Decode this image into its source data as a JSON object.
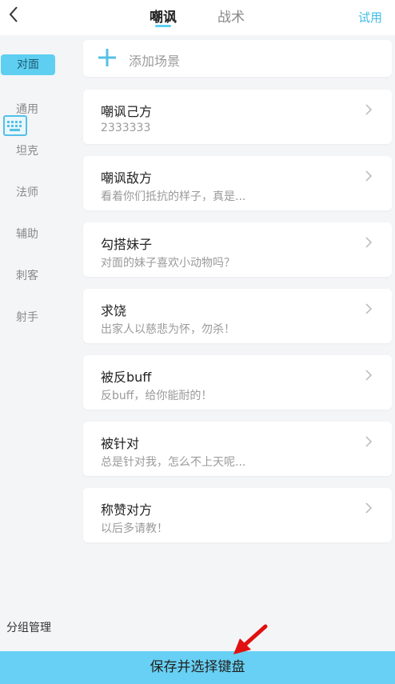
{
  "header": {
    "tabs": [
      {
        "label": "嘲讽",
        "active": true
      },
      {
        "label": "战术",
        "active": false
      }
    ],
    "right_link": "试用"
  },
  "sidebar": {
    "categories": [
      {
        "label": "对面",
        "active": true
      },
      {
        "label": "通用",
        "active": false
      },
      {
        "label": "坦克",
        "active": false
      },
      {
        "label": "法师",
        "active": false
      },
      {
        "label": "辅助",
        "active": false
      },
      {
        "label": "刺客",
        "active": false
      },
      {
        "label": "射手",
        "active": false
      }
    ],
    "group_manage": "分组管理"
  },
  "add_scene": {
    "label": "添加场景"
  },
  "items": [
    {
      "title": "嘲讽己方",
      "subtitle": "2333333"
    },
    {
      "title": "嘲讽敌方",
      "subtitle": "看着你们抵抗的样子，真是..."
    },
    {
      "title": "勾搭妹子",
      "subtitle": "对面的妹子喜欢小动物吗？"
    },
    {
      "title": "求饶",
      "subtitle": "出家人以慈悲为怀，勿杀！"
    },
    {
      "title": "被反buff",
      "subtitle": "反buff，给你能耐的！"
    },
    {
      "title": "被针对",
      "subtitle": "总是针对我，怎么不上天呢..."
    },
    {
      "title": "称赞对方",
      "subtitle": "以后多请教！"
    }
  ],
  "save_button": "保存并选择键盘",
  "colors": {
    "accent": "#5ecff0",
    "bar": "#67d0f4",
    "arrow": "#e01010"
  }
}
